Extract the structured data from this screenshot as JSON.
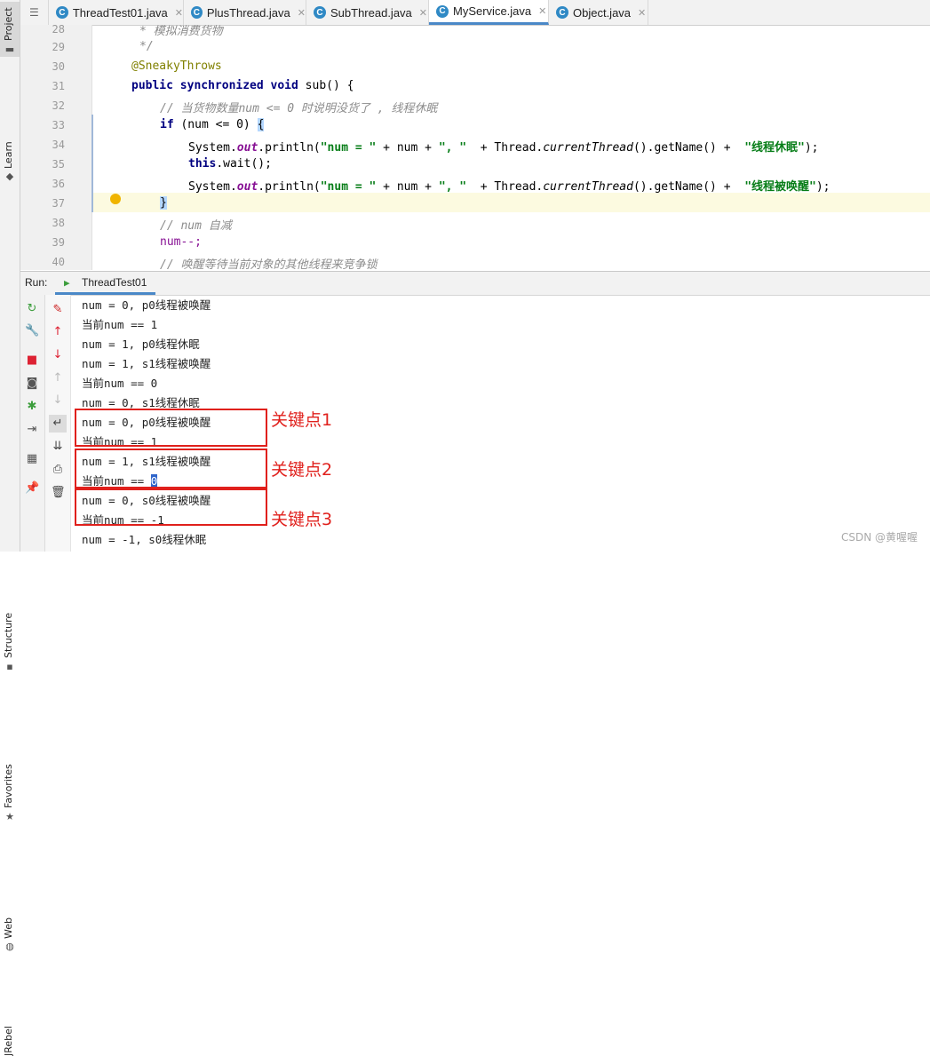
{
  "tool_windows": {
    "project": "Project",
    "learn": "Learn",
    "structure": "Structure",
    "favorites": "Favorites",
    "web": "Web",
    "jrebel": "JRebel"
  },
  "tabs": [
    {
      "label": "ThreadTest01.java",
      "active": false
    },
    {
      "label": "PlusThread.java",
      "active": false
    },
    {
      "label": "SubThread.java",
      "active": false
    },
    {
      "label": "MyService.java",
      "active": true
    },
    {
      "label": "Object.java",
      "active": false
    }
  ],
  "code_lines": {
    "n28": "28",
    "n29": "29",
    "n30": "30",
    "n31": "31",
    "n32": "32",
    "n33": "33",
    "n34": "34",
    "n35": "35",
    "n36": "36",
    "n37": "37",
    "n38": "38",
    "n39": "39",
    "n40": "40",
    "l28": "* 模拟消费货物",
    "l29": "*/",
    "l30": "@SneakyThrows",
    "l31_kw": "public synchronized void",
    "l31_rest": " sub() {",
    "l32": "// 当货物数量num <= 0 时说明没货了 , 线程休眠",
    "l33_kw": "if",
    "l33_rest": " (num <= 0) ",
    "l33_brace": "{",
    "l34_a": "System.",
    "l34_out": "out",
    "l34_b": ".println(",
    "l34_s1": "\"num = \"",
    "l34_c": " + num + ",
    "l34_s2": "\", \"",
    "l34_d": "  + Thread.",
    "l34_cur": "currentThread",
    "l34_e": "().getName() +  ",
    "l34_s3": "\"线程休眠\"",
    "l34_f": ");",
    "l35_kw": "this",
    "l35_rest": ".wait();",
    "l36_s3": "\"线程被唤醒\"",
    "l37": "}",
    "l38": "// num 自减",
    "l39": "num--;",
    "l40": "// 唤醒等待当前对象的其他线程来竞争锁"
  },
  "run": {
    "label": "Run:",
    "config": "ThreadTest01"
  },
  "console": [
    "num = 0, p0线程被唤醒",
    "当前num == 1",
    "num = 1, p0线程休眠",
    "num = 1, s1线程被唤醒",
    "当前num == 0",
    "num = 0, s1线程休眠",
    "num = 0, p0线程被唤醒",
    "当前num == 1",
    "num = 1, s1线程被唤醒",
    "当前num == ",
    "num = 0, s0线程被唤醒",
    "当前num == -1",
    "num = -1, s0线程休眠"
  ],
  "console_selected_value": "0",
  "annotations": [
    "关键点1",
    "关键点2",
    "关键点3"
  ],
  "watermark": "CSDN @黄喔喔",
  "colors": {
    "highlight_box": "#e0201c",
    "active_tab": "#4a88c7"
  }
}
